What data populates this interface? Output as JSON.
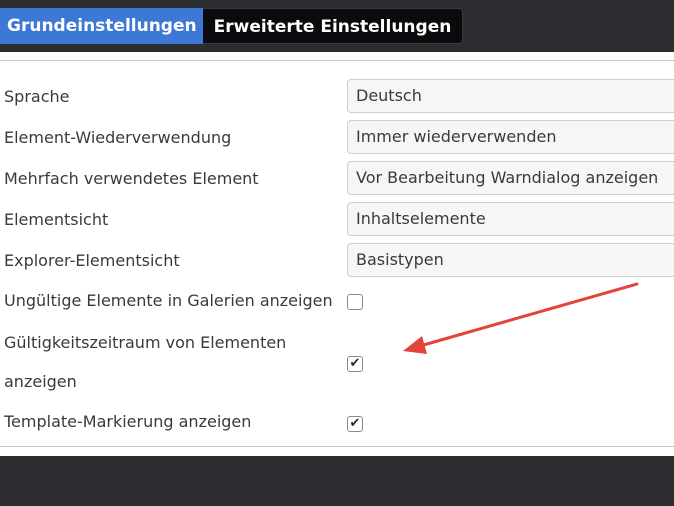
{
  "tabs": {
    "basic_label": "Grundeinstellungen",
    "advanced_label": "Erweiterte Einstellungen"
  },
  "settings": {
    "language_label": "Sprache",
    "language_value": "Deutsch",
    "reuse_label": "Element-Wiederverwendung",
    "reuse_value": "Immer wiederverwenden",
    "multi_label": "Mehrfach verwendetes Element",
    "multi_value": "Vor Bearbeitung Warndialog anzeigen",
    "view_label": "Elementsicht",
    "view_value": "Inhaltselemente",
    "explorer_label": "Explorer-Elementsicht",
    "explorer_value": "Basistypen",
    "invalid_gallery_label": "Ungültige Elemente in Galerien anzeigen",
    "invalid_gallery_checked": false,
    "validity_label_line1": "Gültigkeitszeitraum von Elementen",
    "validity_label_line2": "anzeigen",
    "validity_checked": true,
    "template_label": "Template-Markierung anzeigen",
    "template_checked": true
  },
  "checkmark_glyph": "✔",
  "colors": {
    "active_tab": "#3e78d6",
    "inactive_tab": "#0b0b0d",
    "arrow": "#e2443a"
  }
}
